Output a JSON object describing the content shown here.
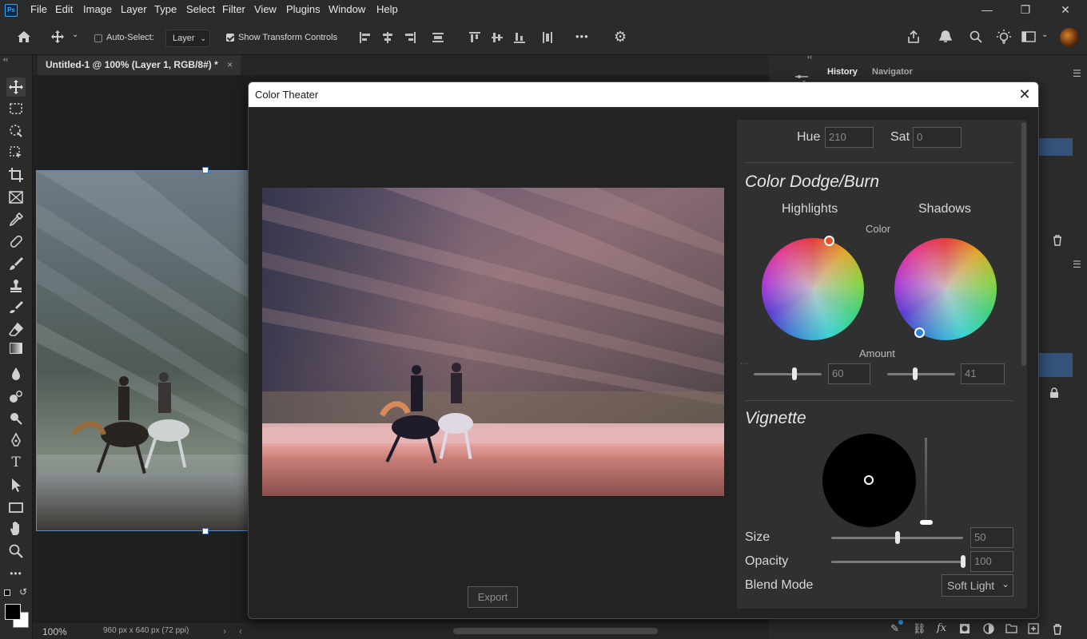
{
  "app": {
    "logo": "Ps",
    "menu": [
      "File",
      "Edit",
      "Image",
      "Layer",
      "Type",
      "Select",
      "Filter",
      "View",
      "Plugins",
      "Window",
      "Help"
    ],
    "window_controls": {
      "minimize": "—",
      "restore": "❐",
      "close": "✕"
    }
  },
  "options_bar": {
    "auto_select_label": "Auto-Select:",
    "auto_select_checked": false,
    "layer_dropdown": "Layer",
    "show_transform_label": "Show Transform Controls",
    "show_transform_checked": true,
    "more_icon": "•••"
  },
  "document": {
    "tab_title": "Untitled-1 @ 100% (Layer 1, RGB/8#) *",
    "tab_close": "×",
    "zoom": "100%",
    "dimensions": "960 px x 640 px (72 ppi)"
  },
  "panels": {
    "collapse_left": "‹‹",
    "collapse_right": "‹‹",
    "tabs": [
      "History",
      "Navigator"
    ],
    "active_tab": "History"
  },
  "dialog": {
    "title": "Color Theater",
    "close_glyph": "✕",
    "export_label": "Export",
    "hue_label": "Hue",
    "hue_value": "210",
    "sat_label": "Sat",
    "sat_value": "0",
    "dodge_burn": {
      "title": "Color Dodge/Burn",
      "highlights_label": "Highlights",
      "shadows_label": "Shadows",
      "color_label": "Color",
      "amount_label": "Amount",
      "highlights_amount": "60",
      "shadows_amount": "41",
      "highlights_amount_fraction": 0.6,
      "shadows_amount_fraction": 0.41
    },
    "vignette": {
      "title": "Vignette",
      "size_label": "Size",
      "size_value": "50",
      "opacity_label": "Opacity",
      "opacity_value": "100",
      "blend_label": "Blend Mode",
      "blend_value": "Soft Light"
    }
  },
  "colors": {
    "accent_blue": "#31a8ff",
    "highlight_dot": "#e8502a",
    "shadow_dot": "#2f7fe0",
    "selection_blue": "#34527a"
  }
}
